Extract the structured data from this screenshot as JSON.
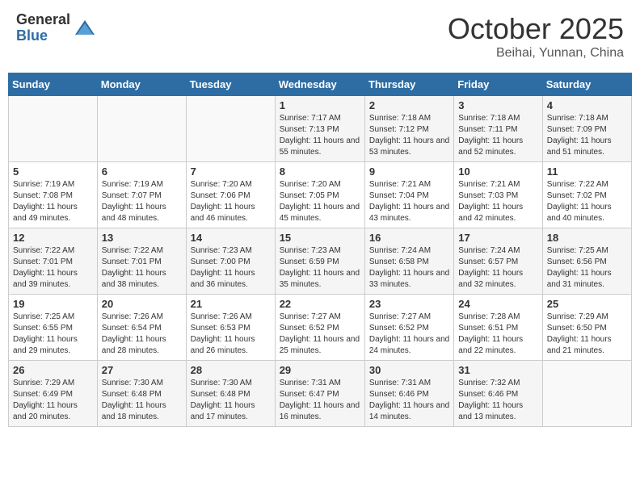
{
  "header": {
    "logo_general": "General",
    "logo_blue": "Blue",
    "month": "October 2025",
    "location": "Beihai, Yunnan, China"
  },
  "days_of_week": [
    "Sunday",
    "Monday",
    "Tuesday",
    "Wednesday",
    "Thursday",
    "Friday",
    "Saturday"
  ],
  "weeks": [
    [
      {
        "day": "",
        "info": ""
      },
      {
        "day": "",
        "info": ""
      },
      {
        "day": "",
        "info": ""
      },
      {
        "day": "1",
        "info": "Sunrise: 7:17 AM\nSunset: 7:13 PM\nDaylight: 11 hours and 55 minutes."
      },
      {
        "day": "2",
        "info": "Sunrise: 7:18 AM\nSunset: 7:12 PM\nDaylight: 11 hours and 53 minutes."
      },
      {
        "day": "3",
        "info": "Sunrise: 7:18 AM\nSunset: 7:11 PM\nDaylight: 11 hours and 52 minutes."
      },
      {
        "day": "4",
        "info": "Sunrise: 7:18 AM\nSunset: 7:09 PM\nDaylight: 11 hours and 51 minutes."
      }
    ],
    [
      {
        "day": "5",
        "info": "Sunrise: 7:19 AM\nSunset: 7:08 PM\nDaylight: 11 hours and 49 minutes."
      },
      {
        "day": "6",
        "info": "Sunrise: 7:19 AM\nSunset: 7:07 PM\nDaylight: 11 hours and 48 minutes."
      },
      {
        "day": "7",
        "info": "Sunrise: 7:20 AM\nSunset: 7:06 PM\nDaylight: 11 hours and 46 minutes."
      },
      {
        "day": "8",
        "info": "Sunrise: 7:20 AM\nSunset: 7:05 PM\nDaylight: 11 hours and 45 minutes."
      },
      {
        "day": "9",
        "info": "Sunrise: 7:21 AM\nSunset: 7:04 PM\nDaylight: 11 hours and 43 minutes."
      },
      {
        "day": "10",
        "info": "Sunrise: 7:21 AM\nSunset: 7:03 PM\nDaylight: 11 hours and 42 minutes."
      },
      {
        "day": "11",
        "info": "Sunrise: 7:22 AM\nSunset: 7:02 PM\nDaylight: 11 hours and 40 minutes."
      }
    ],
    [
      {
        "day": "12",
        "info": "Sunrise: 7:22 AM\nSunset: 7:01 PM\nDaylight: 11 hours and 39 minutes."
      },
      {
        "day": "13",
        "info": "Sunrise: 7:22 AM\nSunset: 7:01 PM\nDaylight: 11 hours and 38 minutes."
      },
      {
        "day": "14",
        "info": "Sunrise: 7:23 AM\nSunset: 7:00 PM\nDaylight: 11 hours and 36 minutes."
      },
      {
        "day": "15",
        "info": "Sunrise: 7:23 AM\nSunset: 6:59 PM\nDaylight: 11 hours and 35 minutes."
      },
      {
        "day": "16",
        "info": "Sunrise: 7:24 AM\nSunset: 6:58 PM\nDaylight: 11 hours and 33 minutes."
      },
      {
        "day": "17",
        "info": "Sunrise: 7:24 AM\nSunset: 6:57 PM\nDaylight: 11 hours and 32 minutes."
      },
      {
        "day": "18",
        "info": "Sunrise: 7:25 AM\nSunset: 6:56 PM\nDaylight: 11 hours and 31 minutes."
      }
    ],
    [
      {
        "day": "19",
        "info": "Sunrise: 7:25 AM\nSunset: 6:55 PM\nDaylight: 11 hours and 29 minutes."
      },
      {
        "day": "20",
        "info": "Sunrise: 7:26 AM\nSunset: 6:54 PM\nDaylight: 11 hours and 28 minutes."
      },
      {
        "day": "21",
        "info": "Sunrise: 7:26 AM\nSunset: 6:53 PM\nDaylight: 11 hours and 26 minutes."
      },
      {
        "day": "22",
        "info": "Sunrise: 7:27 AM\nSunset: 6:52 PM\nDaylight: 11 hours and 25 minutes."
      },
      {
        "day": "23",
        "info": "Sunrise: 7:27 AM\nSunset: 6:52 PM\nDaylight: 11 hours and 24 minutes."
      },
      {
        "day": "24",
        "info": "Sunrise: 7:28 AM\nSunset: 6:51 PM\nDaylight: 11 hours and 22 minutes."
      },
      {
        "day": "25",
        "info": "Sunrise: 7:29 AM\nSunset: 6:50 PM\nDaylight: 11 hours and 21 minutes."
      }
    ],
    [
      {
        "day": "26",
        "info": "Sunrise: 7:29 AM\nSunset: 6:49 PM\nDaylight: 11 hours and 20 minutes."
      },
      {
        "day": "27",
        "info": "Sunrise: 7:30 AM\nSunset: 6:48 PM\nDaylight: 11 hours and 18 minutes."
      },
      {
        "day": "28",
        "info": "Sunrise: 7:30 AM\nSunset: 6:48 PM\nDaylight: 11 hours and 17 minutes."
      },
      {
        "day": "29",
        "info": "Sunrise: 7:31 AM\nSunset: 6:47 PM\nDaylight: 11 hours and 16 minutes."
      },
      {
        "day": "30",
        "info": "Sunrise: 7:31 AM\nSunset: 6:46 PM\nDaylight: 11 hours and 14 minutes."
      },
      {
        "day": "31",
        "info": "Sunrise: 7:32 AM\nSunset: 6:46 PM\nDaylight: 11 hours and 13 minutes."
      },
      {
        "day": "",
        "info": ""
      }
    ]
  ]
}
